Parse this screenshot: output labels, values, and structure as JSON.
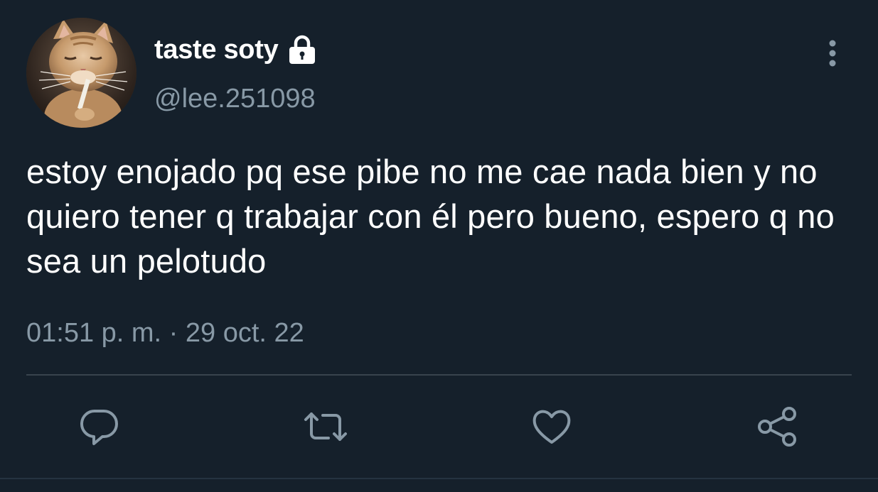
{
  "user": {
    "display_name": "taste soty",
    "handle": "@lee.251098",
    "protected_icon": "lock-icon",
    "avatar": "cat-photo-avatar"
  },
  "tweet": {
    "text": "estoy enojado pq ese pibe no me cae nada bien y no quiero tener q trabajar con él pero bueno, espero q no sea un pelotudo",
    "timestamp": "01:51 p. m. · 29 oct. 22"
  },
  "actions": [
    {
      "name": "reply",
      "icon": "reply-icon"
    },
    {
      "name": "retweet",
      "icon": "retweet-icon"
    },
    {
      "name": "like",
      "icon": "heart-icon"
    },
    {
      "name": "share",
      "icon": "share-icon"
    }
  ],
  "menu_icon": "more-vertical-icon",
  "colors": {
    "background": "#15202b",
    "primary_text": "#ffffff",
    "secondary_text": "#8899a6",
    "divider": "#38444d"
  }
}
